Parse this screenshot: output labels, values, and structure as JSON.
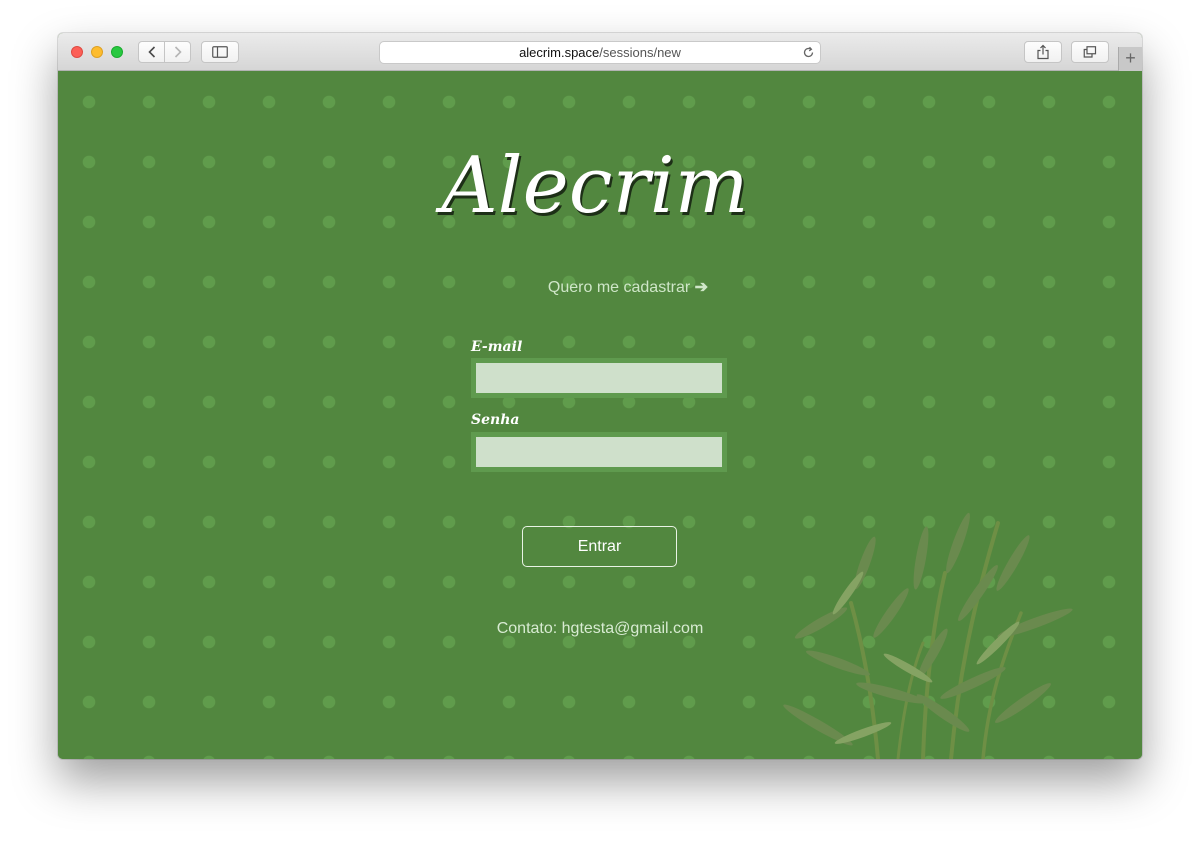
{
  "browser": {
    "url_domain": "alecrim.space",
    "url_path": "/sessions/new",
    "new_tab_label": "+"
  },
  "page": {
    "logo": "Alecrim",
    "register_link": "Quero me cadastrar",
    "register_arrow": "➔",
    "email_label": "E-mail",
    "password_label": "Senha",
    "submit_label": "Entrar",
    "contact": "Contato: hgtesta@gmail.com"
  },
  "colors": {
    "background": "#52873f",
    "dots": "#609c4c",
    "input_fill": "#cfe0cb"
  },
  "icons": [
    "back-icon",
    "forward-icon",
    "sidebar-icon",
    "reload-icon",
    "share-icon",
    "tabs-icon",
    "rosemary-illustration"
  ]
}
